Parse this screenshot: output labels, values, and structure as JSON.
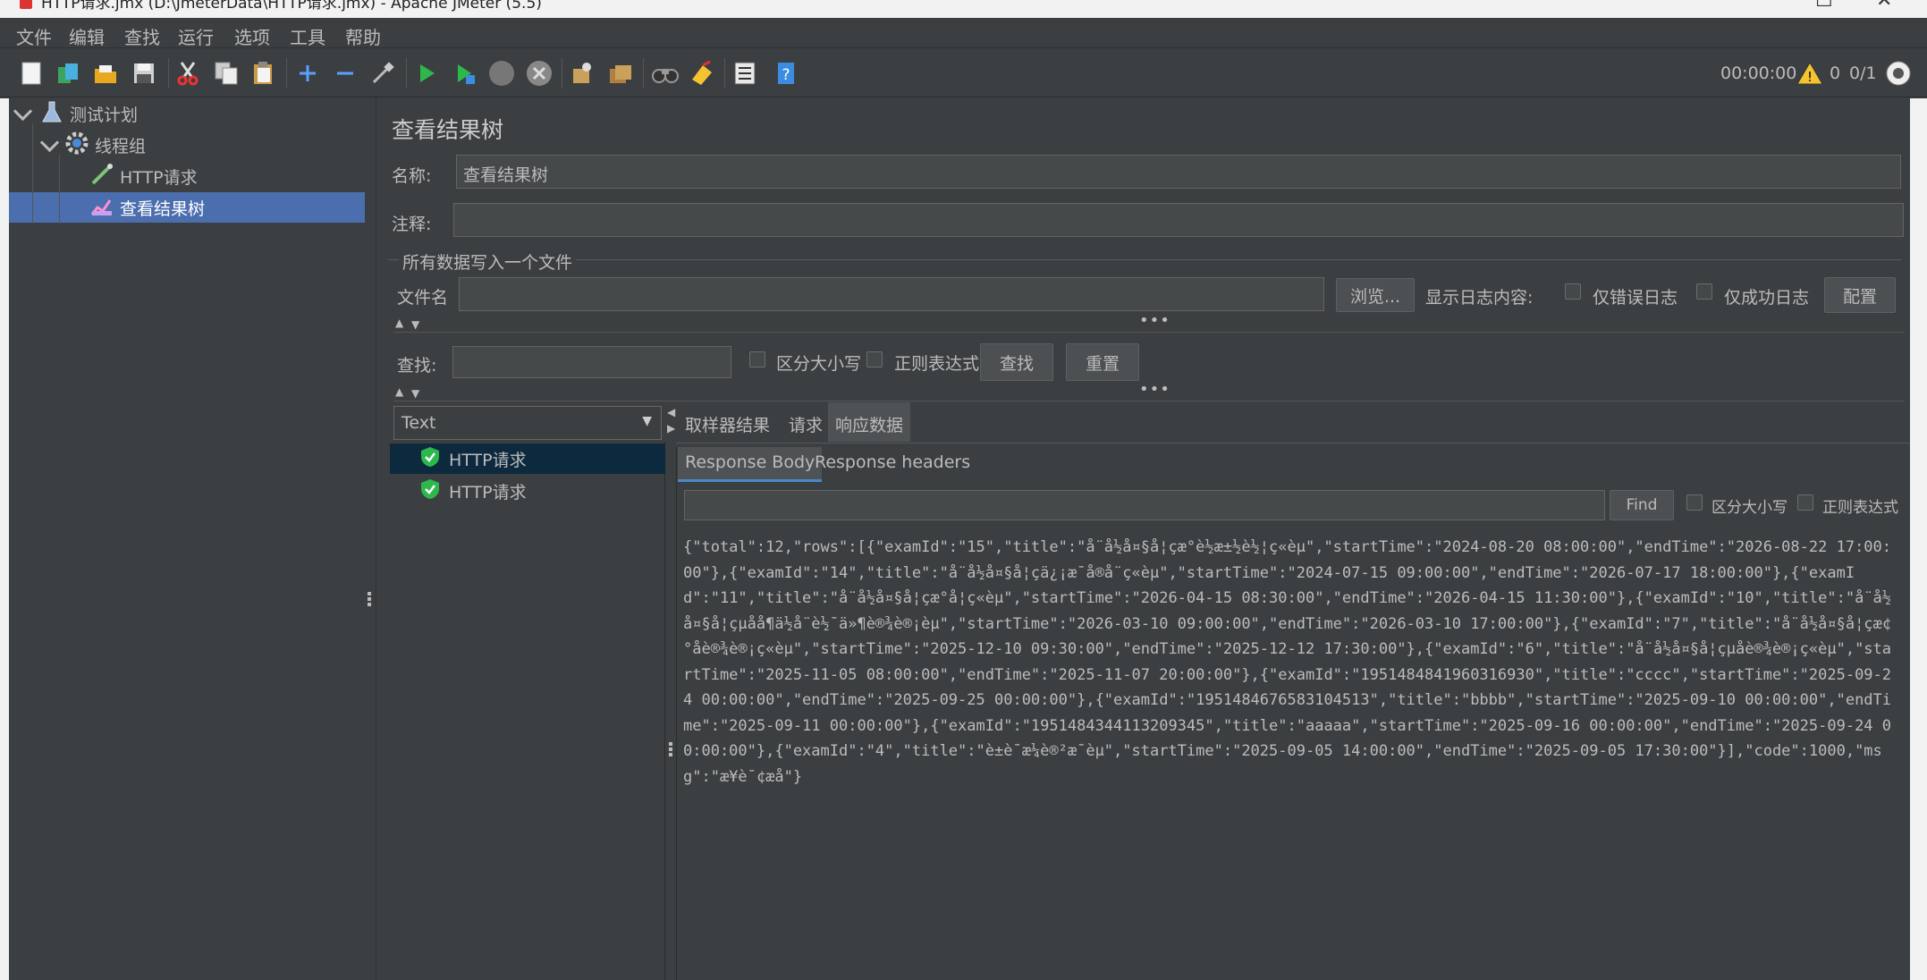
{
  "window": {
    "title": "HTTP请求.jmx (D:\\JmeterData\\HTTP请求.jmx) - Apache JMeter (5.5)"
  },
  "menu": [
    "文件",
    "编辑",
    "查找",
    "运行",
    "选项",
    "工具",
    "帮助"
  ],
  "toolbar": {
    "icons": [
      "new-icon",
      "templates-icon",
      "open-icon",
      "save-icon",
      "cut-icon",
      "copy-icon",
      "paste-icon",
      "expand-icon",
      "collapse-icon",
      "toggle-icon",
      "start-icon",
      "start-no-pause-icon",
      "stop-icon",
      "shutdown-icon",
      "clear-icon",
      "clear-all-icon",
      "search-icon",
      "reset-search-icon",
      "function-helper-icon",
      "help-icon"
    ],
    "timer": "00:00:00",
    "warning_count": "0",
    "thread_count": "0/1"
  },
  "tree": {
    "items": [
      {
        "label": "测试计划",
        "icon": "flask-icon"
      },
      {
        "label": "线程组",
        "icon": "gear-icon"
      },
      {
        "label": "HTTP请求",
        "icon": "pipette-icon"
      },
      {
        "label": "查看结果树",
        "icon": "chart-icon"
      }
    ]
  },
  "panel": {
    "title": "查看结果树",
    "name_label": "名称:",
    "name_value": "查看结果树",
    "comment_label": "注释:",
    "comment_value": "",
    "file_group_label": "所有数据写入一个文件",
    "filename_label": "文件名",
    "filename_value": "",
    "browse_label": "浏览...",
    "log_display_label": "显示日志内容:",
    "errors_only_label": "仅错误日志",
    "success_only_label": "仅成功日志",
    "configure_label": "配置",
    "search_label": "查找:",
    "search_value": "",
    "case_sensitive_label": "区分大小写",
    "regex_label": "正则表达式",
    "search_button": "查找",
    "reset_button": "重置"
  },
  "results": {
    "renderer_selected": "Text",
    "items": [
      "HTTP请求",
      "HTTP请求"
    ]
  },
  "detail_tabs": [
    "取样器结果",
    "请求",
    "响应数据"
  ],
  "response_tabs": [
    "Response Body",
    "Response headers"
  ],
  "response_search": {
    "value": "",
    "find_label": "Find",
    "case_label": "区分大小写",
    "regex_label": "正则表达式"
  },
  "response_body": "{\"total\":12,\"rows\":[{\"examId\":\"15\",\"title\":\"å¨å½å¤§å¦çæ°è½æ±½è½¦ç«èµ\",\"startTime\":\"2024-08-20 08:00:00\",\"endTime\":\"2026-08-22 17:00:00\"},{\"examId\":\"14\",\"title\":\"å¨å½å¤§å¦çä¿¡æ¯å®å¨ç«èµ\",\"startTime\":\"2024-07-15 09:00:00\",\"endTime\":\"2026-07-17 18:00:00\"},{\"examId\":\"11\",\"title\":\"å¨å½å¤§å¦çæ°å¦ç«èµ\",\"startTime\":\"2026-04-15 08:30:00\",\"endTime\":\"2026-04-15 11:30:00\"},{\"examId\":\"10\",\"title\":\"å¨å½å¤§å¦çµå­å¶ä½å¨è½¯ä»¶è®¾è®¡èµ\",\"startTime\":\"2026-03-10 09:00:00\",\"endTime\":\"2026-03-10 17:00:00\"},{\"examId\":\"7\",\"title\":\"å¨å½å¤§å¦çæ¢°åè®¾è®¡ç«èµ\",\"startTime\":\"2025-12-10 09:30:00\",\"endTime\":\"2025-12-12 17:30:00\"},{\"examId\":\"6\",\"title\":\"å¨å½å¤§å¦çµåè®¾è®¡ç«èµ\",\"startTime\":\"2025-11-05 08:00:00\",\"endTime\":\"2025-11-07 20:00:00\"},{\"examId\":\"1951484841960316930\",\"title\":\"cccc\",\"startTime\":\"2025-09-24 00:00:00\",\"endTime\":\"2025-09-25 00:00:00\"},{\"examId\":\"1951484676583104513\",\"title\":\"bbbb\",\"startTime\":\"2025-09-10 00:00:00\",\"endTime\":\"2025-09-11 00:00:00\"},{\"examId\":\"1951484344113209345\",\"title\":\"aaaaa\",\"startTime\":\"2025-09-16 00:00:00\",\"endTime\":\"2025-09-24 00:00:00\"},{\"examId\":\"4\",\"title\":\"è±è¯­æ¼è®²æ¯èµ\",\"startTime\":\"2025-09-05 14:00:00\",\"endTime\":\"2025-09-05 17:30:00\"}],\"code\":1000,\"msg\":\"æ¥è¯¢æå\"}",
  "colors": {
    "bg": "#3c3f41",
    "selection": "#4b6eaf",
    "result_selected": "#0d293e",
    "ok_green": "#2db84c"
  }
}
